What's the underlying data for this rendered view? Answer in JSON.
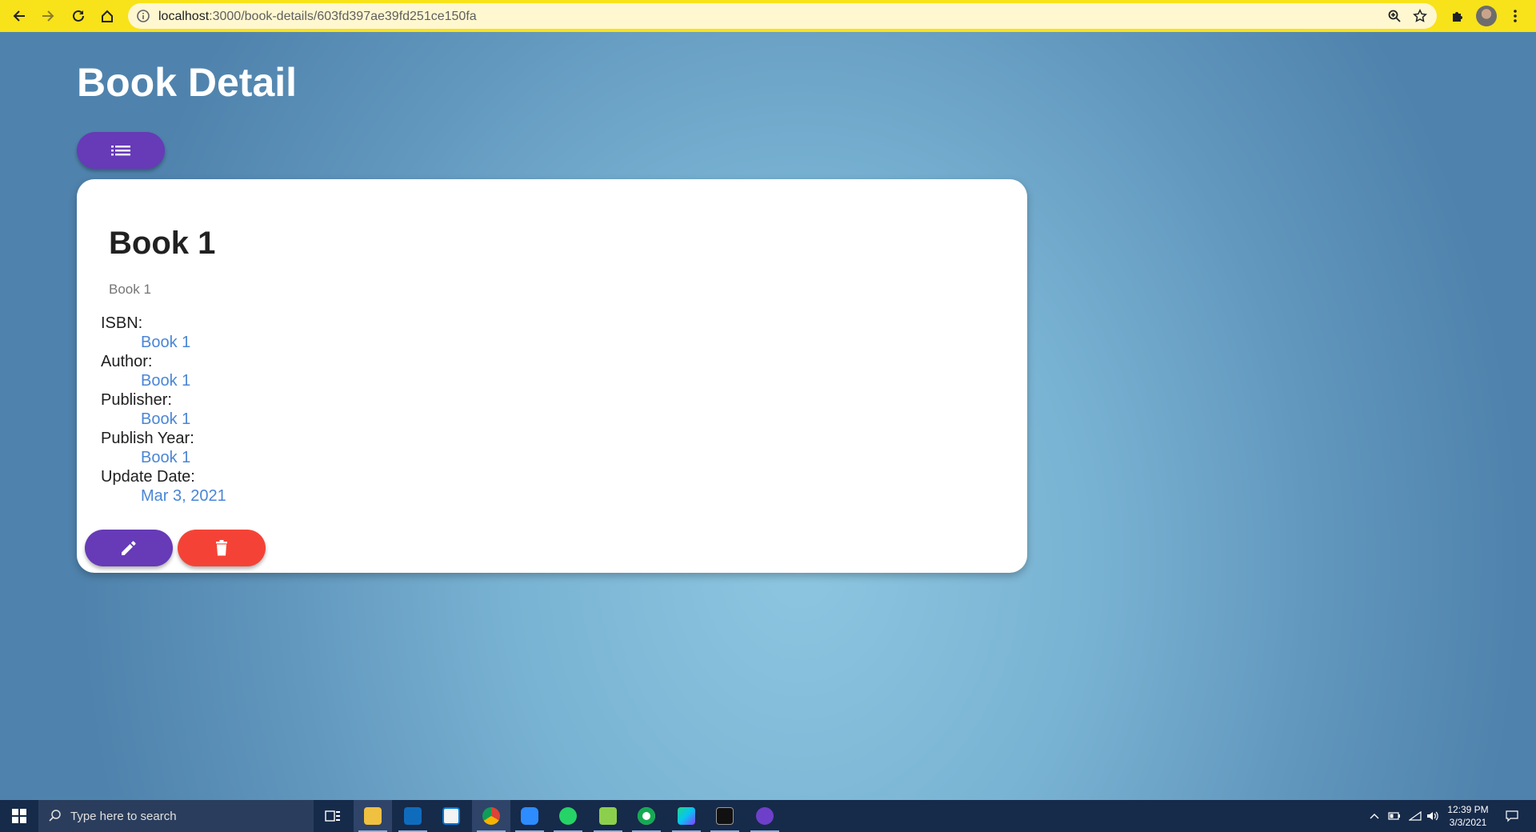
{
  "browser": {
    "url_host": "localhost",
    "url_path": ":3000/book-details/603fd397ae39fd251ce150fa",
    "accent": "#f8e21a"
  },
  "page": {
    "title": "Book Detail"
  },
  "book": {
    "title": "Book 1",
    "subtitle": "Book 1",
    "fields": [
      {
        "label": "ISBN:",
        "value": "Book 1"
      },
      {
        "label": "Author:",
        "value": "Book 1"
      },
      {
        "label": "Publisher:",
        "value": "Book 1"
      },
      {
        "label": "Publish Year:",
        "value": "Book 1"
      },
      {
        "label": "Update Date:",
        "value": "Mar 3, 2021"
      }
    ]
  },
  "actions": {
    "list_icon": "list-icon",
    "edit_icon": "pencil-icon",
    "delete_icon": "trash-icon",
    "primary_color": "#673ab7",
    "danger_color": "#f44336"
  },
  "taskbar": {
    "search_placeholder": "Type here to search",
    "apps": [
      "task-view",
      "file-explorer",
      "outlook",
      "store",
      "chrome",
      "zoom",
      "whatsapp",
      "notepad-plus",
      "mongodb-compass",
      "webstorm",
      "terminal",
      "github-desktop"
    ],
    "time": "12:39 PM",
    "date": "3/3/2021"
  }
}
